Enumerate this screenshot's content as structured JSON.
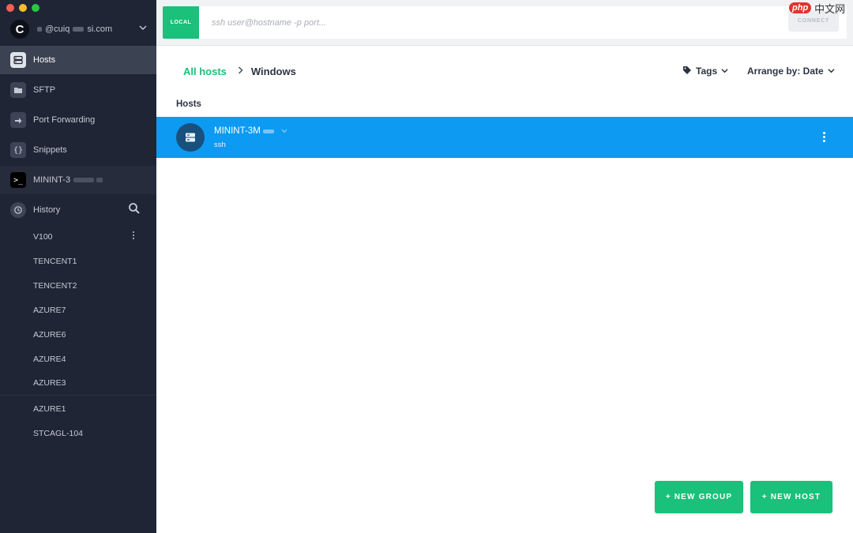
{
  "sidebar": {
    "account": {
      "avatar_letter": "C",
      "email_part1": "@cuiq",
      "email_part2": "si.com"
    },
    "nav": [
      {
        "label": "Hosts",
        "icon": "server-icon"
      },
      {
        "label": "SFTP",
        "icon": "folder-icon"
      },
      {
        "label": "Port Forwarding",
        "icon": "arrow-right-icon"
      },
      {
        "label": "Snippets",
        "icon": "braces-icon"
      },
      {
        "label": "MININT-3",
        "icon": "terminal-icon"
      },
      {
        "label": "History",
        "icon": "history-icon"
      }
    ],
    "history_items": [
      "V100",
      "TENCENT1",
      "TENCENT2",
      "AZURE7",
      "AZURE6",
      "AZURE4",
      "AZURE3",
      "AZURE1",
      "STCAGL-104"
    ]
  },
  "topbar": {
    "local_label": "LOCAL",
    "ssh_placeholder": "ssh user@hostname -p port...",
    "connect_label": "CONNECT",
    "watermark_badge": "php",
    "watermark_text": "中文网"
  },
  "main": {
    "breadcrumb": {
      "root": "All hosts",
      "current": "Windows"
    },
    "tags_label": "Tags",
    "arrange_label": "Arrange by: Date",
    "section_title": "Hosts",
    "hosts": [
      {
        "name": "MININT-3M",
        "subtitle": "ssh"
      }
    ],
    "new_group_label": "+ NEW GROUP",
    "new_host_label": "+ NEW HOST"
  },
  "colors": {
    "accent_green": "#19c17a",
    "selected_blue": "#0d9af2",
    "sidebar_bg": "#1f2534"
  }
}
